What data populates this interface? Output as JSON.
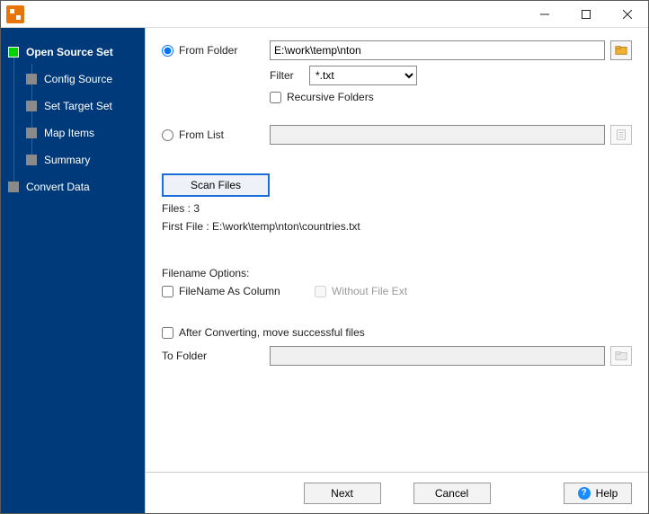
{
  "sidebar": {
    "items": [
      {
        "label": "Open Source Set"
      },
      {
        "label": "Config Source"
      },
      {
        "label": "Set Target Set"
      },
      {
        "label": "Map Items"
      },
      {
        "label": "Summary"
      },
      {
        "label": "Convert Data"
      }
    ]
  },
  "source": {
    "from_folder_label": "From Folder",
    "folder_path": "E:\\work\\temp\\nton",
    "filter_label": "Filter",
    "filter_value": "*.txt",
    "recursive_label": "Recursive Folders",
    "from_list_label": "From List",
    "from_list_value": ""
  },
  "scan": {
    "button_label": "Scan Files",
    "files_label": "Files : 3",
    "first_file_label": "First File : E:\\work\\temp\\nton\\countries.txt"
  },
  "filename_options": {
    "heading": "Filename Options:",
    "as_column_label": "FileName As Column",
    "without_ext_label": "Without File Ext"
  },
  "after": {
    "move_label": "After Converting, move successful files",
    "to_folder_label": "To Folder",
    "to_folder_value": ""
  },
  "footer": {
    "next": "Next",
    "cancel": "Cancel",
    "help": "Help"
  }
}
